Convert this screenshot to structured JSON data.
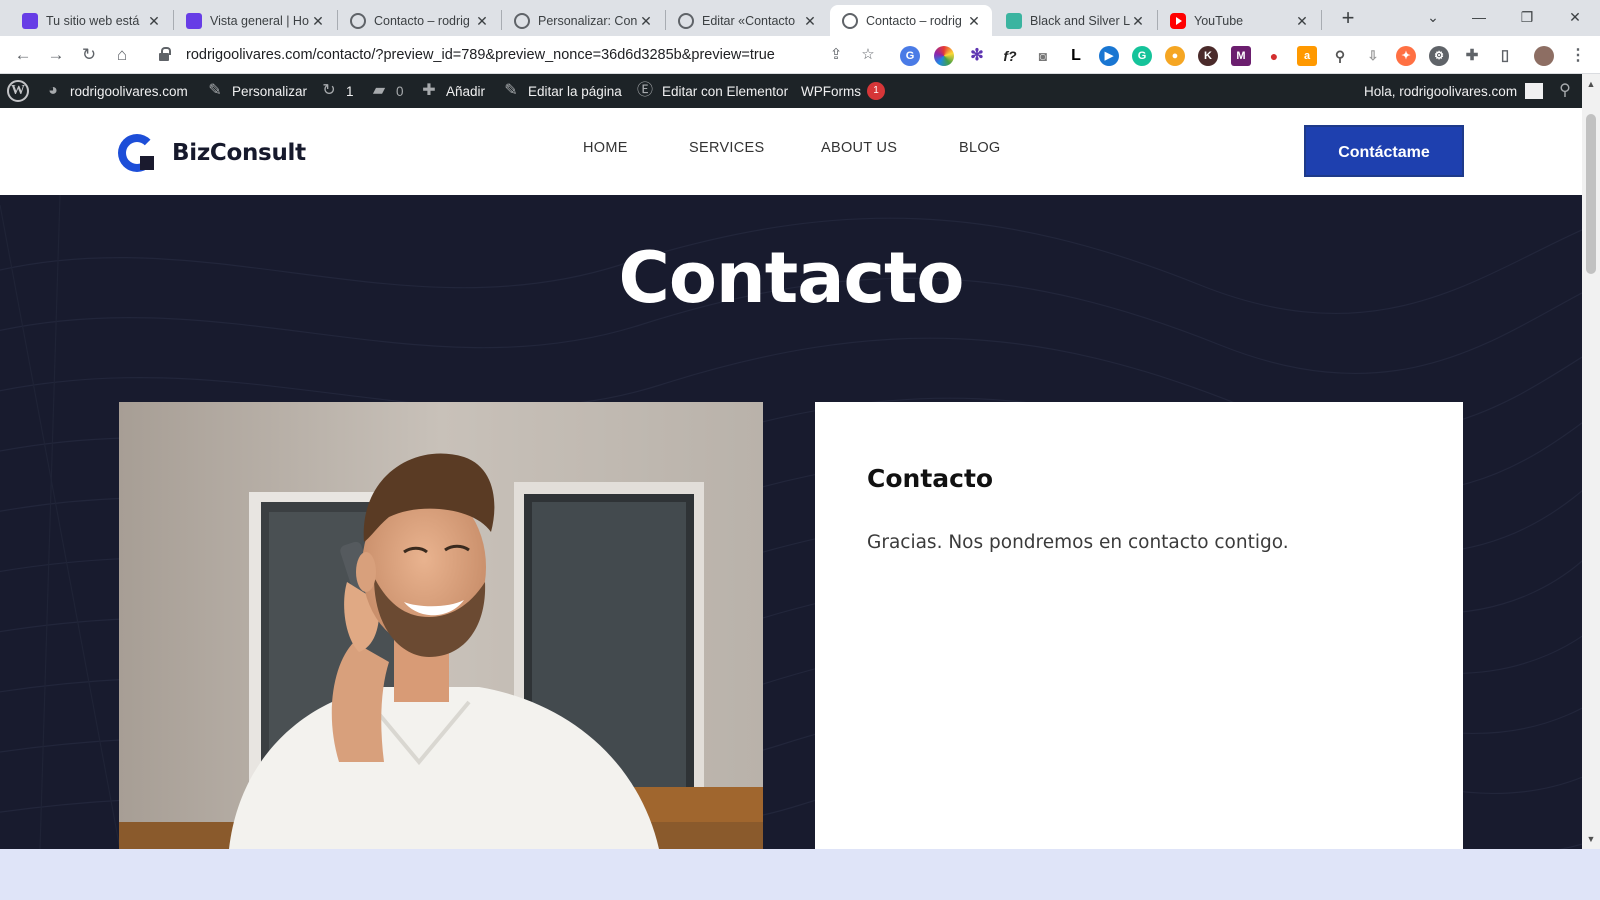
{
  "browser": {
    "tabs": [
      {
        "title": "Tu sitio web está",
        "icon": "hostinger-icon"
      },
      {
        "title": "Vista general | Ho",
        "icon": "hostinger-icon"
      },
      {
        "title": "Contacto – rodrig",
        "icon": "globe-icon"
      },
      {
        "title": "Personalizar: Con",
        "icon": "globe-icon"
      },
      {
        "title": "Editar «Contacto",
        "icon": "globe-icon"
      },
      {
        "title": "Contacto – rodrig",
        "icon": "globe-icon",
        "active": true
      },
      {
        "title": "Black and Silver L",
        "icon": "p-icon"
      },
      {
        "title": "YouTube",
        "icon": "youtube-icon"
      }
    ],
    "url": "rodrigoolivares.com/contacto/?preview_id=789&preview_nonce=36d6d3285b&preview=true"
  },
  "adminbar": {
    "site": "rodrigoolivares.com",
    "customize": "Personalizar",
    "updates": "1",
    "comments": "0",
    "new": "Añadir",
    "edit_page": "Editar la página",
    "edit_elementor": "Editar con Elementor",
    "wpforms": "WPForms",
    "wpforms_badge": "1",
    "greeting": "Hola, rodrigoolivares.com"
  },
  "header": {
    "brand": "BizConsult",
    "nav": [
      "HOME",
      "SERVICES",
      "ABOUT US",
      "BLOG"
    ],
    "cta": "Contáctame"
  },
  "hero": {
    "title": "Contacto",
    "card_title": "Contacto",
    "card_message": "Gracias. Nos pondremos en contacto contigo."
  },
  "colors": {
    "hero_bg": "#181b2e",
    "accent": "#1e40af",
    "adminbar": "#1d2327"
  }
}
